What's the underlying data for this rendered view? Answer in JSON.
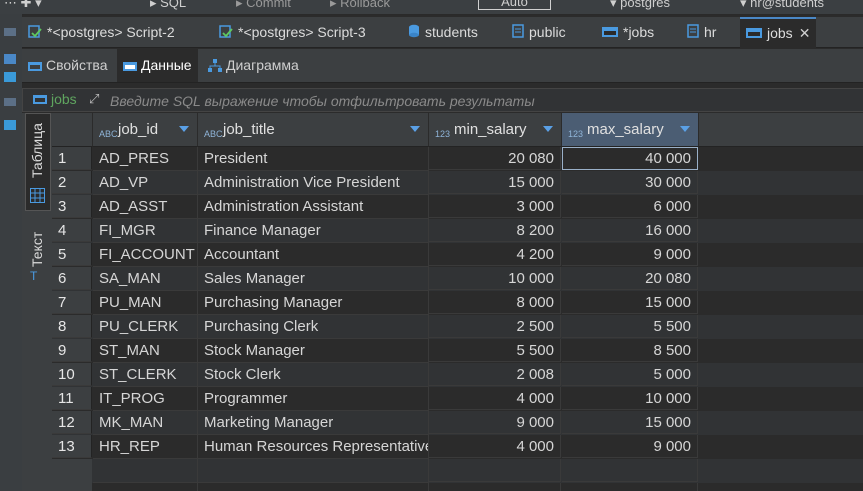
{
  "toolbar": {
    "sql_label": "SQL",
    "commit_label": "Commit",
    "rollback_label": "Rollback",
    "mode_label": "Auto",
    "datasource_label": "postgres",
    "connection_label": "hr@students"
  },
  "editor_tabs": [
    {
      "label": "*<postgres> Script-2",
      "icon": "sql-script-icon"
    },
    {
      "label": "*<postgres> Script-3",
      "icon": "sql-script-icon"
    },
    {
      "label": "students",
      "icon": "database-icon"
    },
    {
      "label": "public",
      "icon": "schema-icon"
    },
    {
      "label": "*jobs",
      "icon": "table-icon"
    },
    {
      "label": "hr",
      "icon": "schema-icon"
    },
    {
      "label": "jobs",
      "icon": "table-icon",
      "active": true
    }
  ],
  "sub_tabs": [
    {
      "label": "Свойства"
    },
    {
      "label": "Данные",
      "active": true
    },
    {
      "label": "Диаграмма"
    }
  ],
  "filter": {
    "table_label": "jobs",
    "placeholder": "Введите SQL выражение чтобы отфильтровать результаты"
  },
  "side_tabs": {
    "table_label": "Таблица",
    "text_label": "Текст"
  },
  "grid": {
    "columns": [
      {
        "name": "job_id",
        "type": "ABC"
      },
      {
        "name": "job_title",
        "type": "ABC"
      },
      {
        "name": "min_salary",
        "type": "123"
      },
      {
        "name": "max_salary",
        "type": "123"
      }
    ],
    "rows": [
      [
        "1",
        "AD_PRES",
        "President",
        "20 080",
        "40 000"
      ],
      [
        "2",
        "AD_VP",
        "Administration Vice President",
        "15 000",
        "30 000"
      ],
      [
        "3",
        "AD_ASST",
        "Administration Assistant",
        "3 000",
        "6 000"
      ],
      [
        "4",
        "FI_MGR",
        "Finance Manager",
        "8 200",
        "16 000"
      ],
      [
        "5",
        "FI_ACCOUNT",
        "Accountant",
        "4 200",
        "9 000"
      ],
      [
        "6",
        "SA_MAN",
        "Sales Manager",
        "10 000",
        "20 080"
      ],
      [
        "7",
        "PU_MAN",
        "Purchasing Manager",
        "8 000",
        "15 000"
      ],
      [
        "8",
        "PU_CLERK",
        "Purchasing Clerk",
        "2 500",
        "5 500"
      ],
      [
        "9",
        "ST_MAN",
        "Stock Manager",
        "5 500",
        "8 500"
      ],
      [
        "10",
        "ST_CLERK",
        "Stock Clerk",
        "2 008",
        "5 000"
      ],
      [
        "11",
        "IT_PROG",
        "Programmer",
        "4 000",
        "10 000"
      ],
      [
        "12",
        "MK_MAN",
        "Marketing Manager",
        "9 000",
        "15 000"
      ],
      [
        "13",
        "HR_REP",
        "Human Resources Representative",
        "4 000",
        "9 000"
      ]
    ]
  },
  "colors": {
    "accent": "#4a88c7",
    "selected_column": "#4b5d73",
    "header_bg": "#3c3f41",
    "body_bg": "#2b2b2b"
  }
}
